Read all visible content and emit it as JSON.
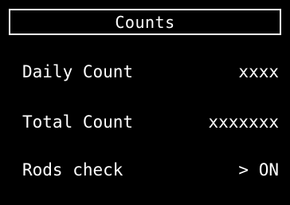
{
  "title": "Counts",
  "rows": [
    {
      "label": "Daily Count",
      "value": "xxxx"
    },
    {
      "label": "Total Count",
      "value": "xxxxxxx"
    },
    {
      "label": "Rods check",
      "value": "> ON"
    }
  ],
  "colors": {
    "background": "#000000",
    "foreground": "#ffffff"
  }
}
